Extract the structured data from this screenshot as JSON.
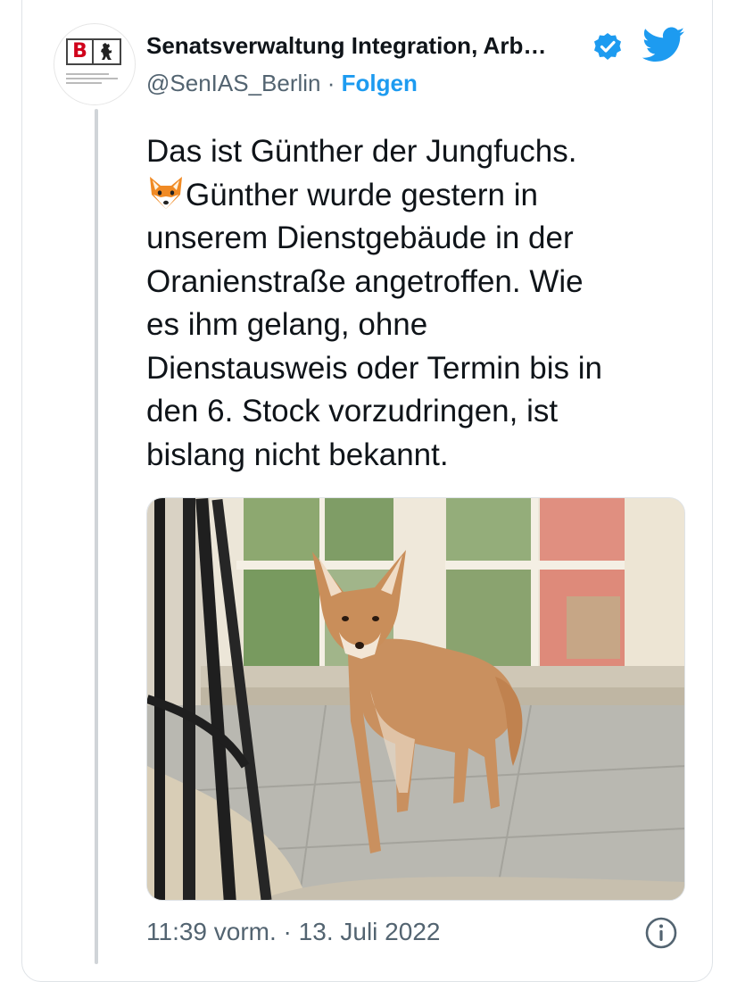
{
  "author": {
    "name": "Senatsverwaltung Integration, Arb…",
    "handle": "@SenIAS_Berlin",
    "separator": " · ",
    "follow_label": "Folgen",
    "avatar_letter": "B"
  },
  "tweet": {
    "lines": [
      "Das ist Günther der Jungfuchs.",
      "Günther wurde gestern in",
      "unserem Dienstgebäude in der",
      "Oranienstraße angetroffen. Wie",
      "es ihm gelang, ohne",
      "Dienstausweis oder Termin bis in",
      "den 6. Stock vorzudringen, ist",
      "bislang nicht bekannt."
    ],
    "emoji": "fox-face-emoji",
    "image": "photo of a young fox standing on a stone floor in front of a window"
  },
  "footer": {
    "time": "11:39 vorm.",
    "separator": " · ",
    "date": "13. Juli 2022"
  },
  "icons": {
    "verified": "verified-badge-icon",
    "brand": "twitter-bird-icon",
    "info": "info-icon"
  },
  "colors": {
    "accent": "#1d9bf0",
    "text": "#0f1419",
    "secondary": "#536471",
    "logo_red": "#d0021b"
  }
}
